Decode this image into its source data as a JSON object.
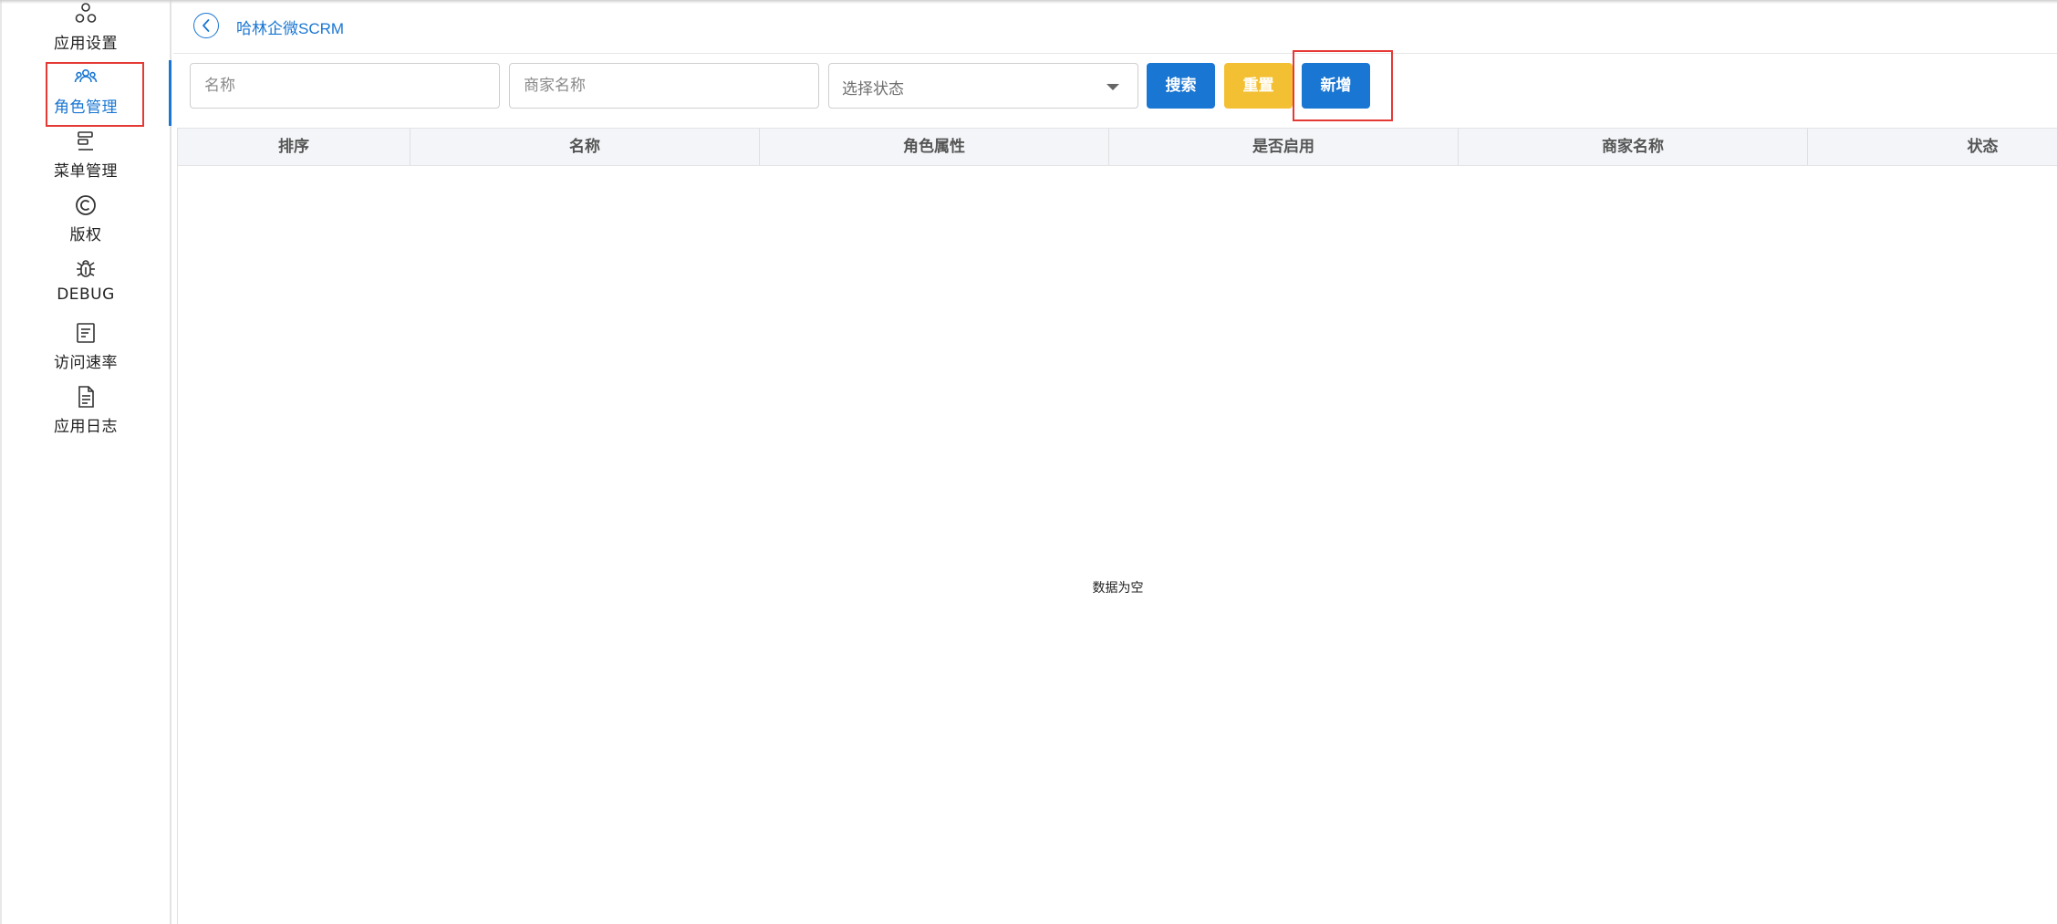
{
  "sidebar": {
    "items": [
      {
        "label": "应用设置",
        "icon": "app-settings-icon"
      },
      {
        "label": "角色管理",
        "icon": "role-users-icon",
        "active": true
      },
      {
        "label": "菜单管理",
        "icon": "menu-icon"
      },
      {
        "label": "版权",
        "icon": "copyright-icon"
      },
      {
        "label": "DEBUG",
        "icon": "bug-icon"
      },
      {
        "label": "访问速率",
        "icon": "rate-list-icon"
      },
      {
        "label": "应用日志",
        "icon": "log-file-icon"
      }
    ]
  },
  "header": {
    "title": "哈林企微SCRM"
  },
  "filters": {
    "name_placeholder": "名称",
    "merchant_placeholder": "商家名称",
    "status_placeholder": "选择状态"
  },
  "buttons": {
    "search": "搜索",
    "reset": "重置",
    "add": "新增"
  },
  "table": {
    "columns": [
      "排序",
      "名称",
      "角色属性",
      "是否启用",
      "商家名称",
      "状态"
    ],
    "empty_text": "数据为空"
  },
  "colors": {
    "primary": "#1976d2",
    "warning": "#f4c033",
    "highlight": "#e53935"
  }
}
